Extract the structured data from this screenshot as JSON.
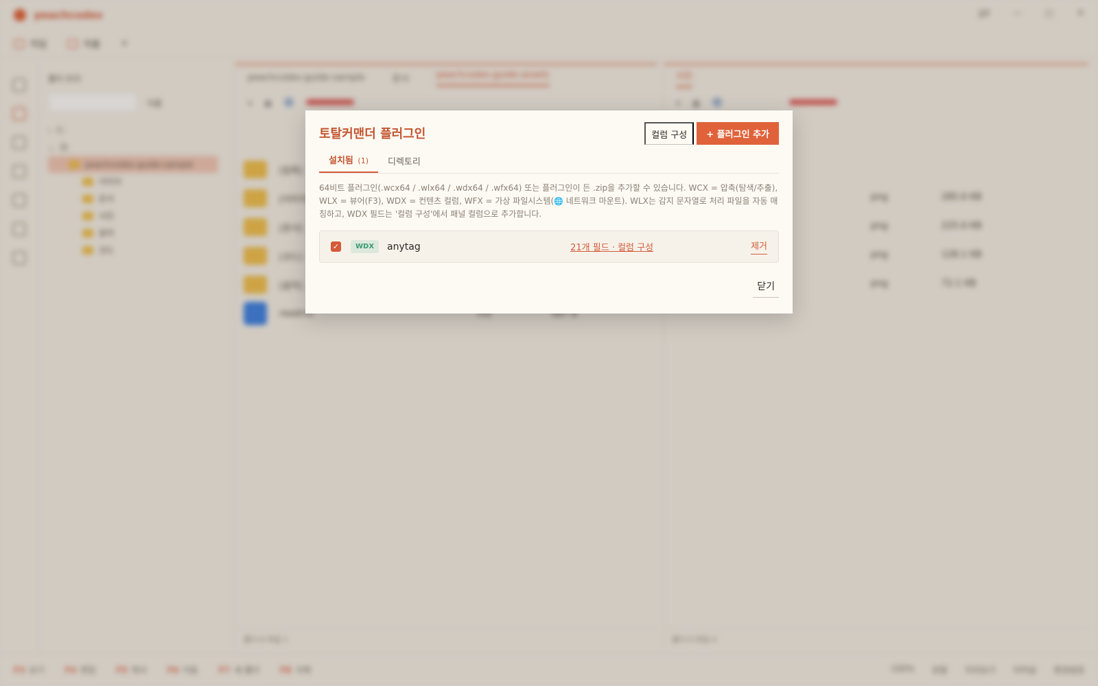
{
  "app": {
    "brand": "peachcodes",
    "title_right": {
      "user": "jjd",
      "min_icon": "minimize-icon",
      "max_icon": "maximize-icon",
      "close_icon": "close-icon"
    },
    "toolbar": {
      "items": [
        "작업",
        "작품"
      ]
    },
    "tree": {
      "header": "폴더 트리",
      "search_placeholder": "폴더 찾기...",
      "sort": "이름",
      "rows": [
        "C:",
        "D:",
        "peachcodes-guide-sample",
        "이미지",
        "문서",
        "사진",
        "음악",
        "코드"
      ]
    },
    "left_panel": {
      "tabs": [
        "peachcodes-guide-sample",
        "문서",
        "peachcodes-guide-assets"
      ],
      "rows": [
        {
          "name": "[압축]",
          "type": "",
          "size": "",
          "date": ""
        },
        {
          "name": "[이미지]",
          "type": "",
          "size": "",
          "date": ""
        },
        {
          "name": "[문서]",
          "type": "",
          "size": "",
          "date": ""
        },
        {
          "name": "[코드]",
          "type": "",
          "size": "",
          "date": ""
        },
        {
          "name": "[음악]",
          "type": "",
          "size": "",
          "date": ""
        },
        {
          "name": "readme",
          "type": "md",
          "size": "687 B",
          "date": ""
        }
      ],
      "footer": "폴더 6 파일 1"
    },
    "right_panel": {
      "tabs": [
        "사진"
      ],
      "rows": [
        {
          "type": "png",
          "size": "285.6 KB"
        },
        {
          "type": "png",
          "size": "225.6 KB"
        },
        {
          "type": "png",
          "size": "128.1 KB"
        },
        {
          "type": "png",
          "size": "72.1 KB"
        }
      ],
      "footer": "폴더 0 파일 4"
    },
    "statusbar": {
      "keys": [
        {
          "k": "F3",
          "label": "보기"
        },
        {
          "k": "F4",
          "label": "편집"
        },
        {
          "k": "F5",
          "label": "복사"
        },
        {
          "k": "F6",
          "label": "이동"
        },
        {
          "k": "F7",
          "label": "새 폴더"
        },
        {
          "k": "F8",
          "label": "삭제"
        }
      ],
      "right": [
        "100%",
        "분할",
        "미리보기",
        "터미널",
        "환경설정"
      ]
    }
  },
  "modal": {
    "title": "토탈커맨더 플러그인",
    "column_config_button": "컬럼 구성",
    "add_plugin_button": "+ 플러그인 추가",
    "tabs": [
      {
        "label": "설치됨",
        "count": "(1)",
        "active": true
      },
      {
        "label": "디렉토리",
        "count": "",
        "active": false
      }
    ],
    "description_1": "64비트 플러그인(.wcx64 / .wlx64 / .wdx64 / .wfx64) 또는 플러그인이 든 .zip을 추가할 수 있습니다. WCX = 압축(탐색/추출), WLX = 뷰어(F3), WDX = 컨텐츠 컬럼, WFX = 가상 파일시스템(",
    "description_globe": "🌐",
    "description_2": " 네트워크 마운트). WLX는 감지 문자열로 처리 파일을 자동 매칭하고, WDX 필드는 '컬럼 구성'에서 패널 컬럼으로 추가합니다.",
    "plugins": [
      {
        "enabled": true,
        "type": "WDX",
        "name": "anytag",
        "link": "21개 필드 · 컬럼 구성",
        "remove": "제거"
      }
    ],
    "close_button": "닫기",
    "colors": {
      "accent": "#d45a3a",
      "primary_button": "#e0623a",
      "badge_text": "#3a9a6e",
      "badge_bg": "#dde8dc"
    }
  }
}
